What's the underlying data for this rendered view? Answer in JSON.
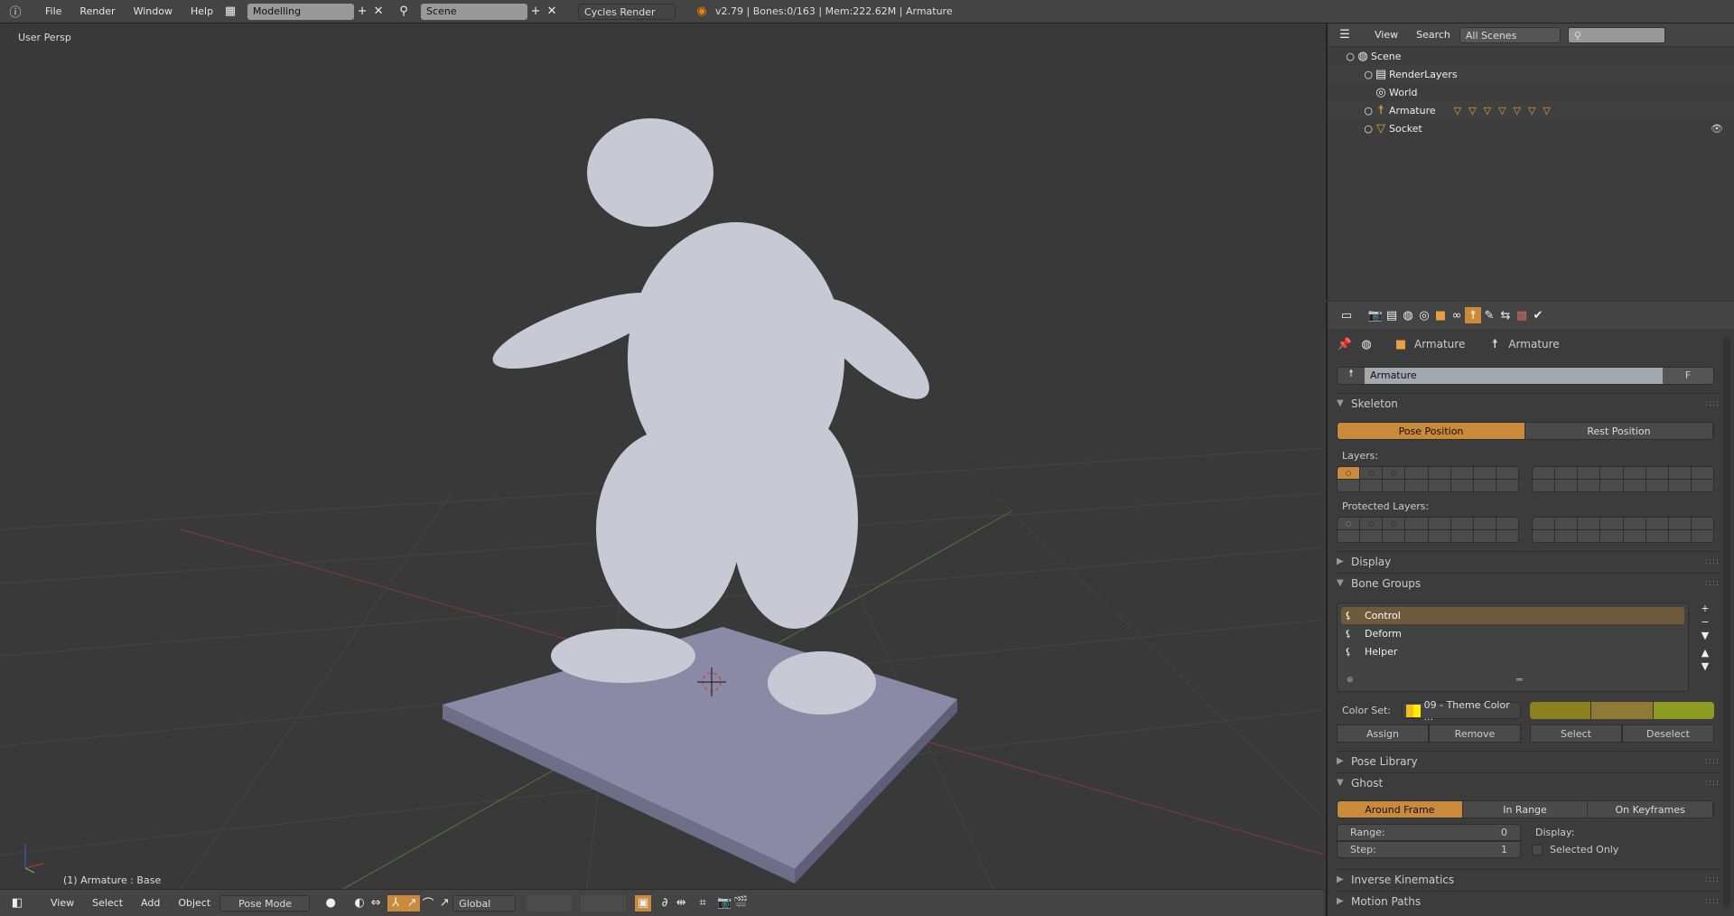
{
  "topbar": {
    "menus": [
      "File",
      "Render",
      "Window",
      "Help"
    ],
    "layout": "Modelling",
    "scene": "Scene",
    "engine": "Cycles Render",
    "stats": "v2.79 | Bones:0/163  | Mem:222.62M | Armature"
  },
  "viewport": {
    "view_label": "User Persp",
    "status": "(1) Armature : Base"
  },
  "bottombar": {
    "menus": [
      "View",
      "Select",
      "Add",
      "Object"
    ],
    "mode": "Pose Mode",
    "orientation": "Global"
  },
  "outliner": {
    "menus": [
      "View",
      "Search"
    ],
    "scenes_select": "All Scenes",
    "items": [
      {
        "name": "Scene",
        "indent": 0
      },
      {
        "name": "RenderLayers",
        "indent": 1
      },
      {
        "name": "World",
        "indent": 1
      },
      {
        "name": "Armature",
        "indent": 1
      },
      {
        "name": "Socket",
        "indent": 1
      }
    ]
  },
  "properties": {
    "breadcrumb": [
      "Armature",
      "Armature"
    ],
    "datablock_name": "Armature",
    "fake_user": "F",
    "skeleton": {
      "title": "Skeleton",
      "pose_position": "Pose Position",
      "rest_position": "Rest Position",
      "layers_label": "Layers:",
      "protected_label": "Protected Layers:"
    },
    "display_title": "Display",
    "bone_groups": {
      "title": "Bone Groups",
      "items": [
        "Control",
        "Deform",
        "Helper"
      ],
      "selected": "Control",
      "color_set_label": "Color Set:",
      "color_set": "09 - Theme Color ...",
      "colors": [
        "#8c801e",
        "#8e7a35",
        "#8f9a20"
      ],
      "assign": "Assign",
      "remove": "Remove",
      "select": "Select",
      "deselect": "Deselect"
    },
    "pose_library_title": "Pose Library",
    "ghost": {
      "title": "Ghost",
      "modes": [
        "Around Frame",
        "In Range",
        "On Keyframes"
      ],
      "range_label": "Range:",
      "range": "0",
      "step_label": "Step:",
      "step": "1",
      "display_label": "Display:",
      "selected_only": "Selected Only"
    },
    "ik_title": "Inverse Kinematics",
    "motion_paths_title": "Motion Paths"
  }
}
